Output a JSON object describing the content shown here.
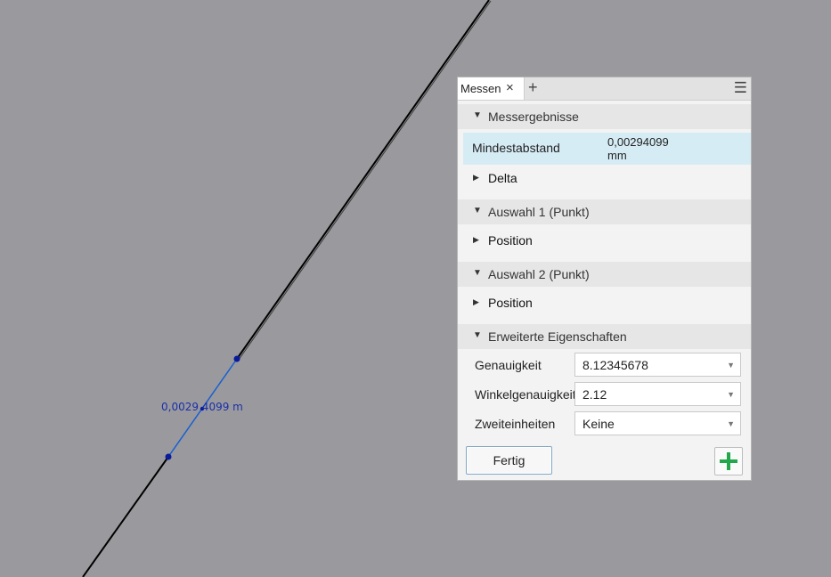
{
  "viewport": {
    "dimension_label": "0,0029 4099 m",
    "colors": {
      "background": "#9a9a9e",
      "edge_line": "#000000",
      "measure_line": "#1a5fd0",
      "point": "#0a1a9a"
    }
  },
  "panel": {
    "tab_label": "Messen",
    "tab_close_icon": "×",
    "tab_add_icon": "+",
    "menu_icon": "☰",
    "results": {
      "header": "Messergebnisse",
      "min_distance_label": "Mindestabstand",
      "min_distance_value": "0,00294099",
      "min_distance_unit": "mm",
      "delta_label": "Delta"
    },
    "selection1": {
      "header": "Auswahl 1 (Punkt)",
      "position_label": "Position"
    },
    "selection2": {
      "header": "Auswahl 2 (Punkt)",
      "position_label": "Position"
    },
    "advanced": {
      "header": "Erweiterte Eigenschaften",
      "precision_label": "Genauigkeit",
      "precision_value": "8.12345678",
      "angle_precision_label": "Winkelgenauigkeit",
      "angle_precision_value": "2.12",
      "dual_units_label": "Zweiteinheiten",
      "dual_units_value": "Keine"
    },
    "done_button": "Fertig",
    "add_button_icon": "plus-icon",
    "colors": {
      "selected_row": "#d6ecf5",
      "add_icon": "#22a84a",
      "button_border": "#7fa8c8"
    }
  }
}
